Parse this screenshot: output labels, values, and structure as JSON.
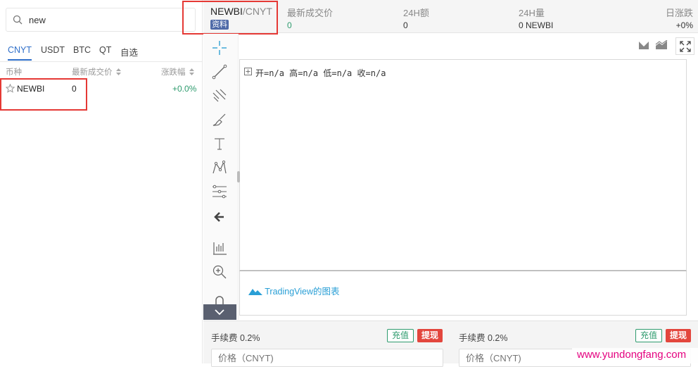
{
  "search": {
    "value": "new"
  },
  "tabs": [
    {
      "label": "CNYT",
      "active": true
    },
    {
      "label": "USDT"
    },
    {
      "label": "BTC"
    },
    {
      "label": "QT"
    },
    {
      "label": "自选"
    }
  ],
  "columns": {
    "coin": "币种",
    "last_price": "最新成交价",
    "change": "涨跌幅"
  },
  "rows": [
    {
      "name": "NEWBI",
      "price": "0",
      "change": "+0.0%"
    }
  ],
  "header": {
    "base": "NEWBI",
    "quote": "/CNYT",
    "info_badge": "资料",
    "stats": [
      {
        "label": "最新成交价",
        "value": "0"
      },
      {
        "label": "24H额",
        "value": "0"
      },
      {
        "label": "24H量",
        "value": "0 NEWBI"
      },
      {
        "label": "日涨跌",
        "value": "+0%"
      }
    ]
  },
  "chart": {
    "ohlc": [
      {
        "label": "开",
        "value": "n/a"
      },
      {
        "label": "高",
        "value": "n/a"
      },
      {
        "label": "低",
        "value": "n/a"
      },
      {
        "label": "收",
        "value": "n/a"
      }
    ],
    "attribution": "TradingView的图表"
  },
  "trade": {
    "left": {
      "fee": "手续费 0.2%",
      "deposit": "充值",
      "withdraw": "提现",
      "price_placeholder": "价格（CNYT)"
    },
    "right": {
      "fee": "手续费 0.2%",
      "deposit": "充值",
      "withdraw": "提现",
      "price_placeholder": "价格（CNYT)"
    }
  },
  "watermark": "www.yundongfang.com",
  "colors": {
    "accent": "#2f6fc9",
    "up": "#2e9b6e",
    "down": "#e3463d",
    "highlight": "#e53935",
    "watermark": "#e4007f"
  }
}
